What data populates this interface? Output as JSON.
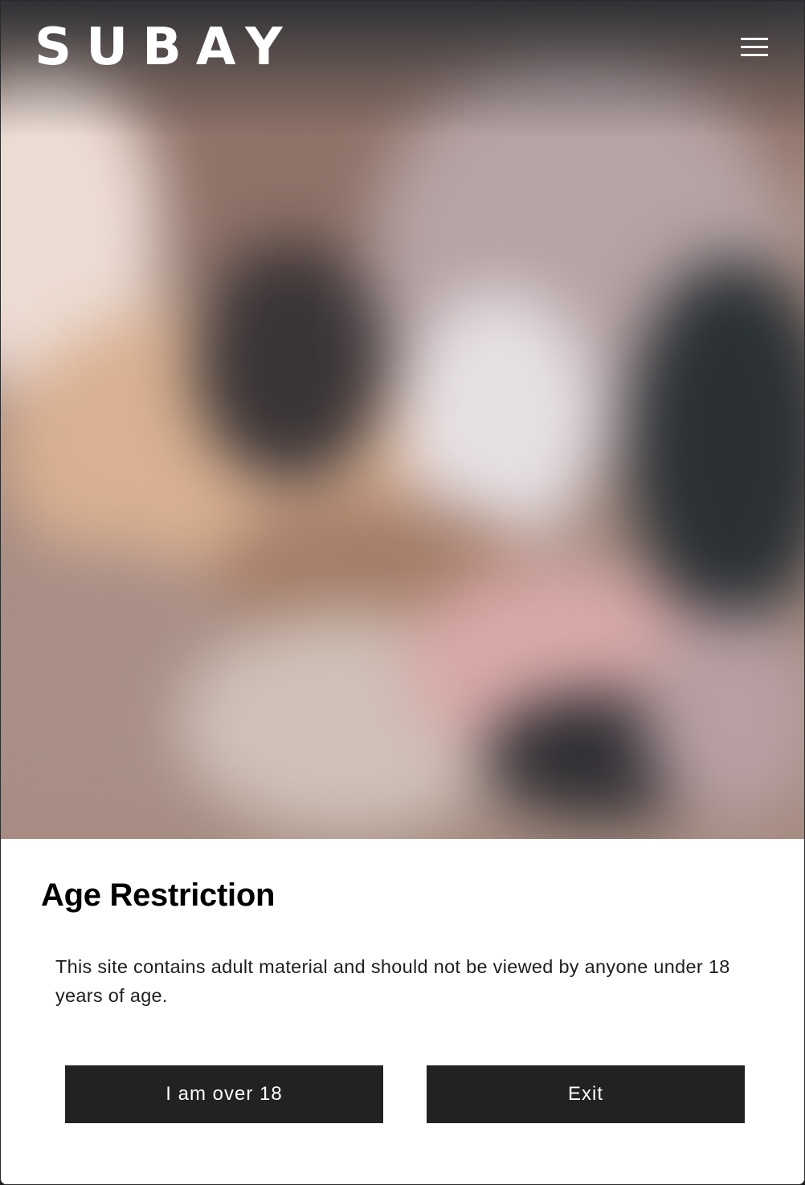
{
  "header": {
    "logo_text": "SUBAY",
    "menu_icon": "hamburger-menu-icon"
  },
  "age_gate": {
    "title": "Age Restriction",
    "message": "This site contains adult material and should not be viewed by anyone under 18 years of age.",
    "confirm_label": "I am over 18",
    "exit_label": "Exit"
  },
  "colors": {
    "button_background": "#222222",
    "button_text": "#ffffff",
    "panel_background": "#ffffff"
  }
}
